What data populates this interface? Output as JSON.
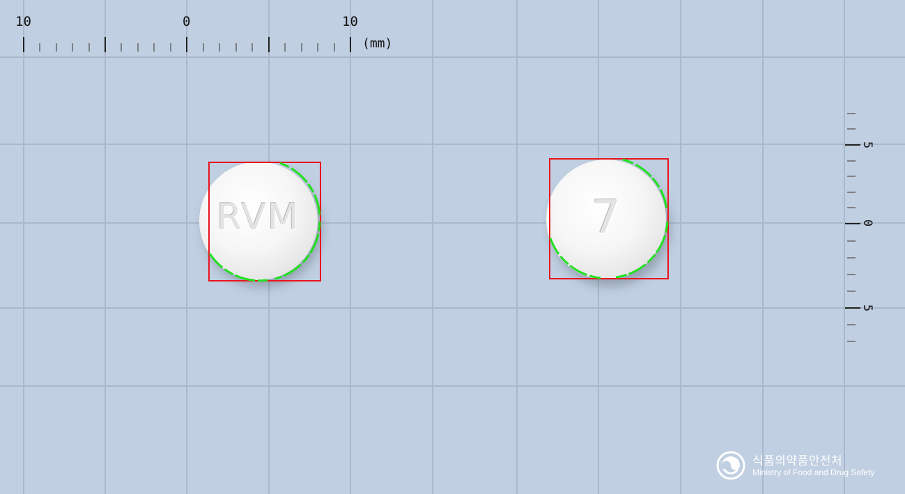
{
  "scale": {
    "unit_label": "(mm)",
    "horizontal_labels": [
      "10",
      "0",
      "10"
    ],
    "vertical_labels": [
      "5",
      "0",
      "5"
    ]
  },
  "pills": [
    {
      "imprint": "RVM",
      "color": "#f4f4f4"
    },
    {
      "imprint": "7",
      "color": "#f4f4f4"
    }
  ],
  "colors": {
    "background": "#c0cfe1",
    "grid_line": "#a9b8cb",
    "bounding_box": "#e8141c",
    "contour": "#22e01f"
  },
  "logo": {
    "korean": "식품의약품안전처",
    "english": "Ministry of Food and Drug Safety"
  }
}
